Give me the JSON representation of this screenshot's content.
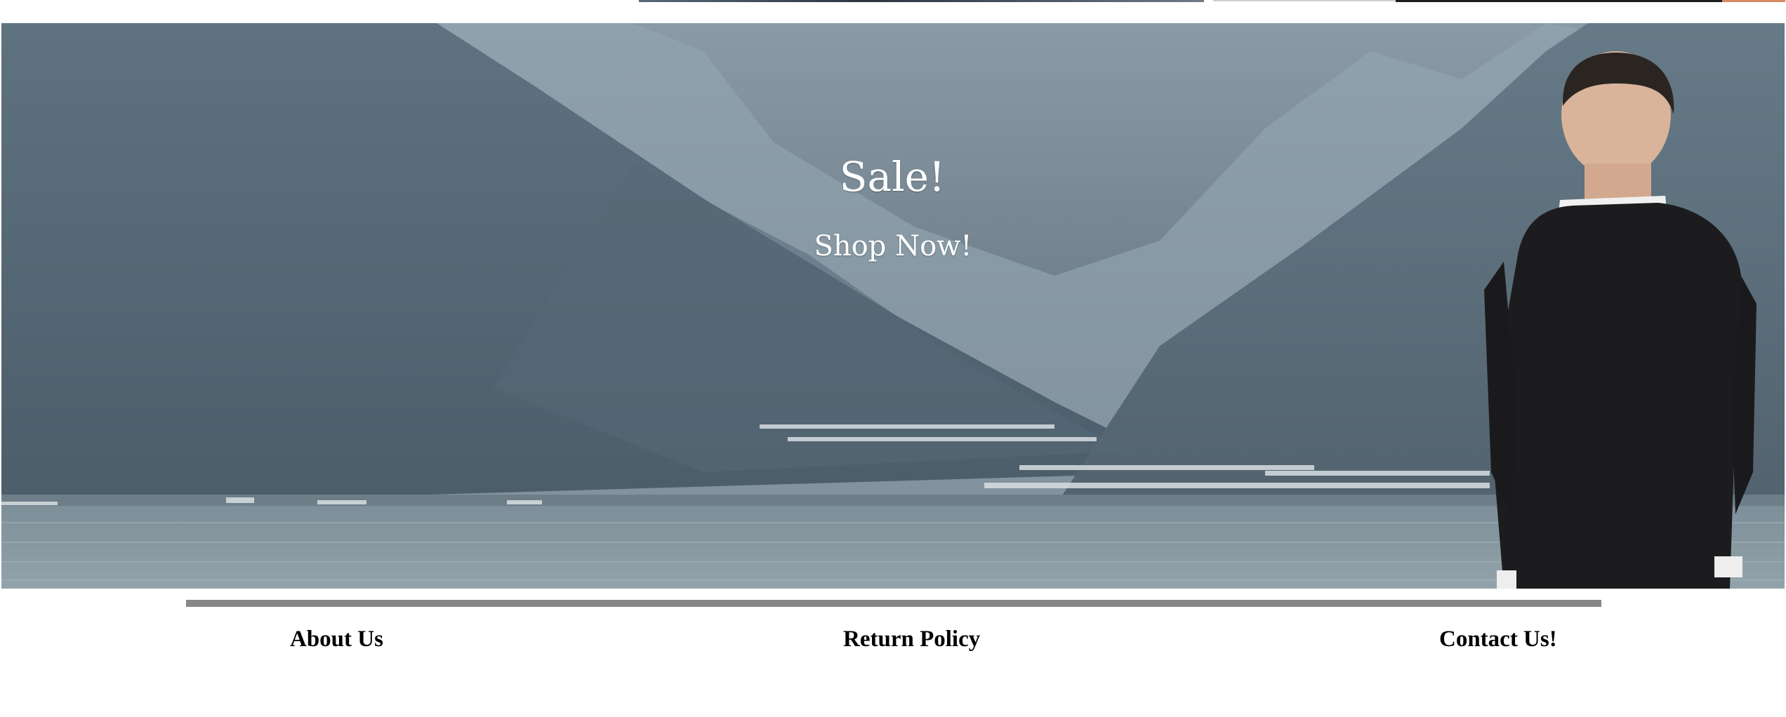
{
  "hero": {
    "title": "Sale!",
    "cta_label": "Shop Now!"
  },
  "footer": {
    "links": [
      {
        "label": "About Us"
      },
      {
        "label": "Return Policy"
      },
      {
        "label": "Contact Us!"
      }
    ]
  },
  "colors": {
    "divider": "#878787",
    "hero_text": "#ffffff",
    "footer_text": "#000000"
  }
}
